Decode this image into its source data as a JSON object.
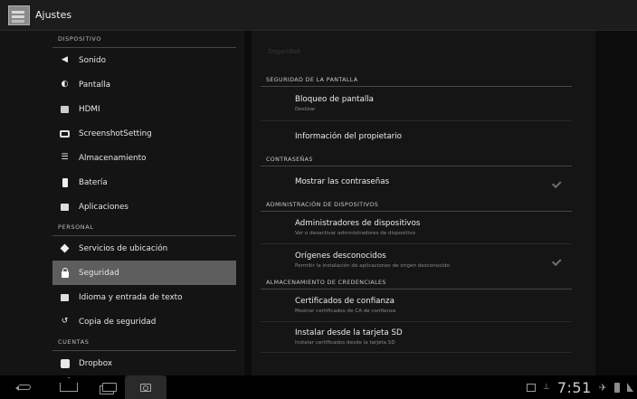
{
  "app": {
    "title": "Ajustes"
  },
  "left_pane": {
    "sections": [
      {
        "header": "DISPOSITIVO",
        "items": [
          {
            "label": "Sonido",
            "icon": "speaker-icon"
          },
          {
            "label": "Pantalla",
            "icon": "brightness-icon"
          },
          {
            "label": "HDMI",
            "icon": "hdmi-icon"
          },
          {
            "label": "ScreenshotSetting",
            "icon": "camera-icon"
          },
          {
            "label": "Almacenamiento",
            "icon": "storage-icon"
          },
          {
            "label": "Batería",
            "icon": "battery-icon"
          },
          {
            "label": "Aplicaciones",
            "icon": "apps-icon"
          }
        ]
      },
      {
        "header": "PERSONAL",
        "items": [
          {
            "label": "Servicios de ubicación",
            "icon": "location-icon"
          },
          {
            "label": "Seguridad",
            "icon": "lock-icon",
            "selected": true
          },
          {
            "label": "Idioma y entrada de texto",
            "icon": "language-icon"
          },
          {
            "label": "Copia de seguridad",
            "icon": "backup-icon"
          }
        ]
      },
      {
        "header": "CUENTAS",
        "items": [
          {
            "label": "Dropbox",
            "icon": "dropbox-icon"
          }
        ]
      }
    ]
  },
  "right_pane": {
    "title": "Seguridad",
    "sections": [
      {
        "header": "SEGURIDAD DE LA PANTALLA",
        "items": [
          {
            "title": "Bloqueo de pantalla",
            "subtitle": "Deslizar"
          },
          {
            "title": "Información del propietario"
          }
        ]
      },
      {
        "header": "CONTRASEÑAS",
        "items": [
          {
            "title": "Mostrar las contraseñas",
            "checked": true
          }
        ]
      },
      {
        "header": "ADMINISTRACIÓN DE DISPOSITIVOS",
        "items": [
          {
            "title": "Administradores de dispositivos",
            "subtitle": "Ver o desactivar administradores de dispositivo"
          },
          {
            "title": "Orígenes desconocidos",
            "subtitle": "Permitir la instalación de aplicaciones de origen desconocido",
            "checked": true
          }
        ]
      },
      {
        "header": "ALMACENAMIENTO DE CREDENCIALES",
        "items": [
          {
            "title": "Certificados de confianza",
            "subtitle": "Mostrar certificados de CA de confianza"
          },
          {
            "title": "Instalar desde la tarjeta SD",
            "subtitle": "Instalar certificados desde la tarjeta SD"
          }
        ]
      }
    ]
  },
  "status_bar": {
    "time": "7:51"
  }
}
